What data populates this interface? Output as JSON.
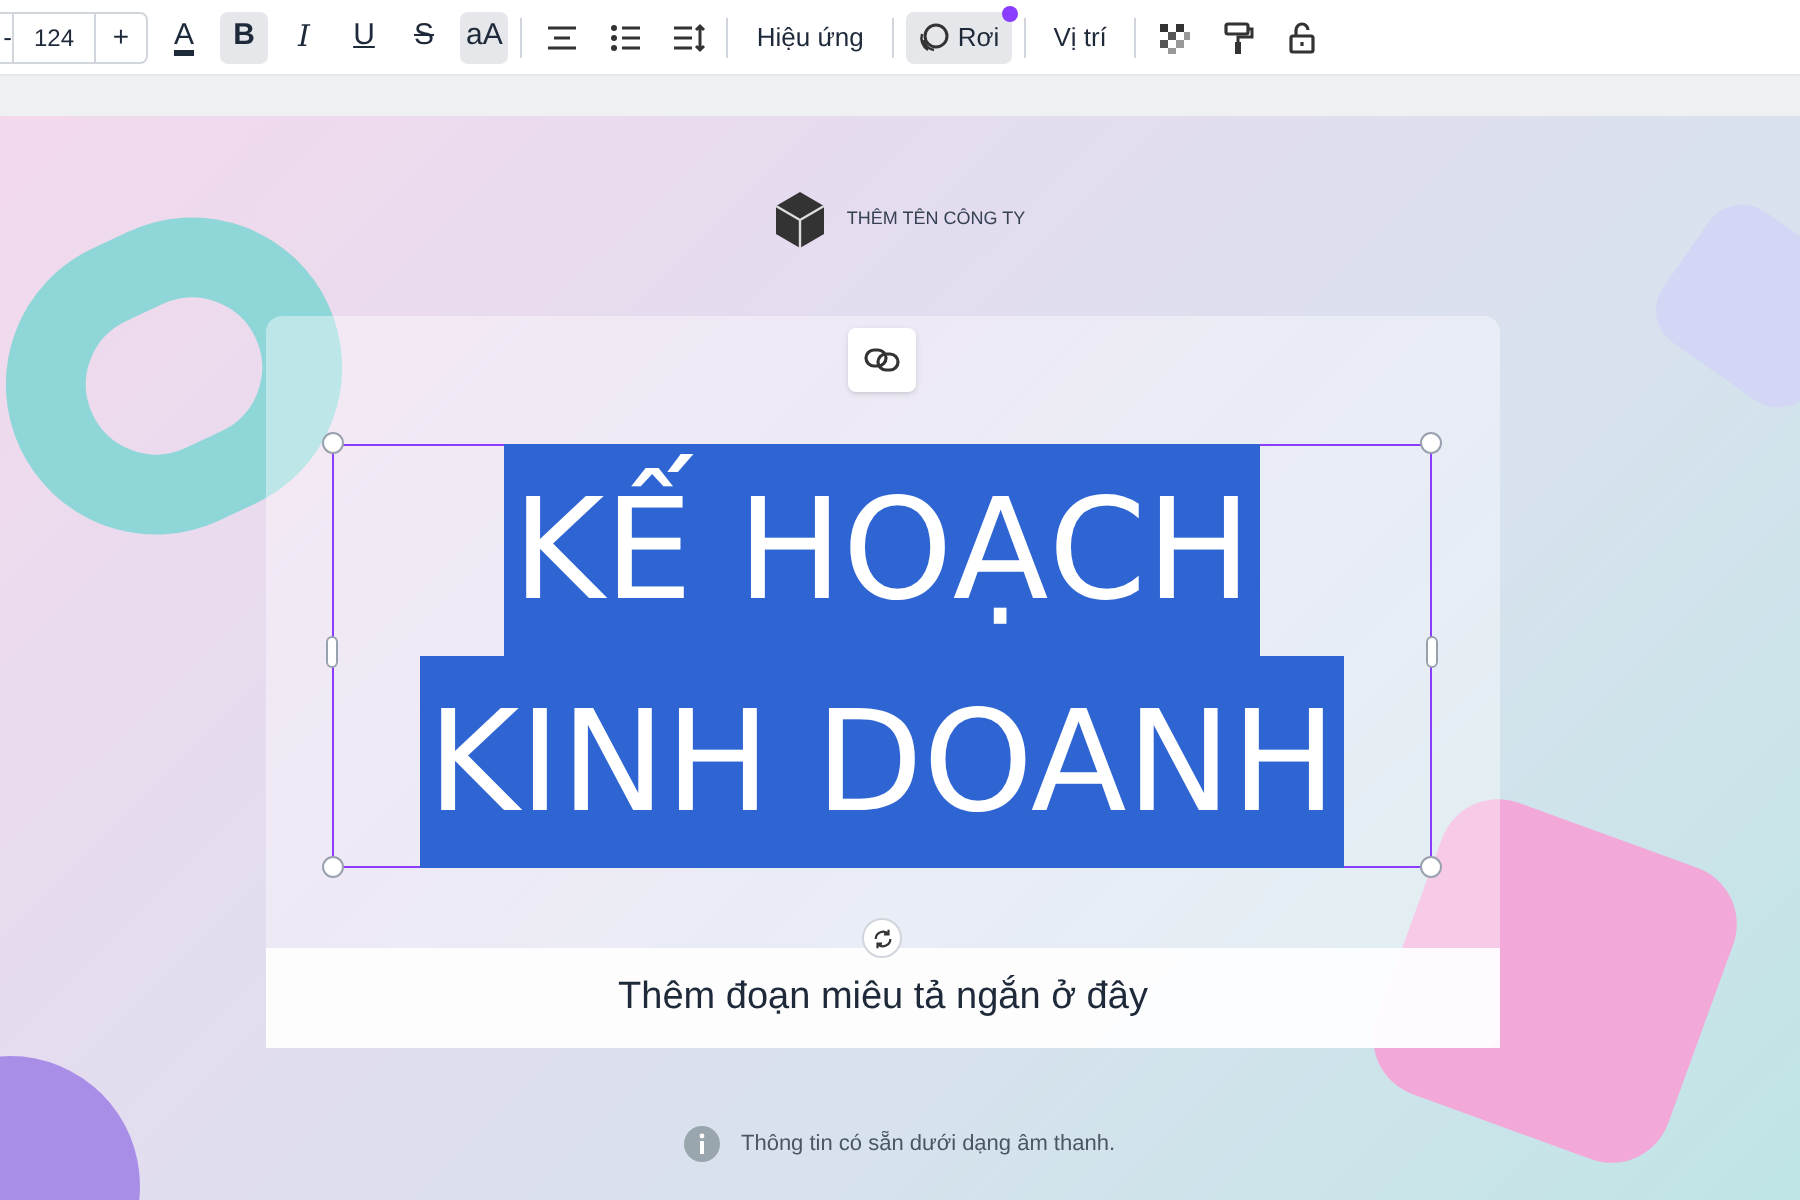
{
  "toolbar": {
    "decrease": "-",
    "font_size": "124",
    "increase": "+",
    "format_buttons": [
      {
        "kind": "color",
        "label": "A",
        "selected": false
      },
      {
        "kind": "bold",
        "label": "B",
        "selected": true
      },
      {
        "kind": "italic",
        "label": "I",
        "selected": false
      },
      {
        "kind": "underline",
        "label": "U",
        "selected": false
      },
      {
        "kind": "strike",
        "label": "S",
        "selected": false
      },
      {
        "kind": "case",
        "label": "aA",
        "selected": true
      }
    ],
    "effects_button": "Hiệu ứng",
    "animation_button": {
      "label": "Rơi",
      "selected": true,
      "badge": true
    },
    "position_button": "Vị trí"
  },
  "canvas": {
    "company": "THÊM TÊN CÔNG TY",
    "title_lines": [
      "KẾ HOẠCH",
      "KINH DOANH"
    ],
    "subtitle": "Thêm đoạn miêu tả ngắn ở đây",
    "info": "Thông tin có sẵn dưới dạng âm thanh."
  }
}
